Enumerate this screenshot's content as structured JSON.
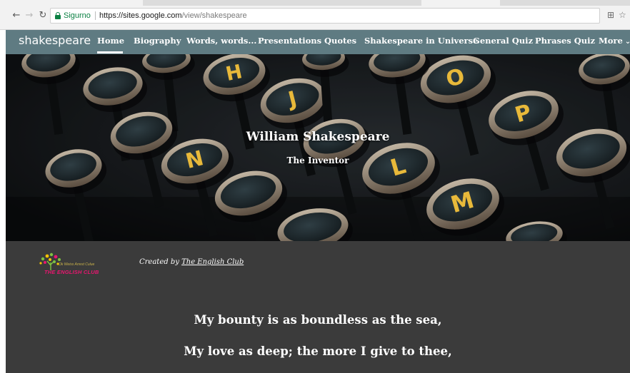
{
  "browser": {
    "secure_label": "Sigurno",
    "url_host": "https://sites.google.com",
    "url_path": "/view/shakespeare"
  },
  "site": {
    "title": "shakespeare",
    "nav": [
      {
        "label": "Home",
        "active": true
      },
      {
        "label": "Biography",
        "active": false
      },
      {
        "label": "Words, words...",
        "active": false
      },
      {
        "label": "Presentations",
        "active": false
      },
      {
        "label": "Quotes",
        "active": false
      },
      {
        "label": "Shakespeare in Universe",
        "active": false
      },
      {
        "label": "General Quiz",
        "active": false
      },
      {
        "label": "Phrases Quiz",
        "active": false
      }
    ],
    "more_label": "More",
    "nav_color": "#5f7b82"
  },
  "hero": {
    "title": "William Shakespeare",
    "subtitle": "The Inventor",
    "key_letters": [
      "H",
      "J",
      "O",
      "P",
      "L",
      "M",
      "N"
    ]
  },
  "content": {
    "background": "#3b3b3b",
    "logo": {
      "tagline": "Ok Weiss Arrest Culue",
      "name": "THE ENGLISH CLUB"
    },
    "credit_prefix": "Created by",
    "credit_link": "The English Club",
    "verse": [
      "My bounty is as boundless as the sea,",
      "My love as deep; the more I give to thee,"
    ]
  }
}
